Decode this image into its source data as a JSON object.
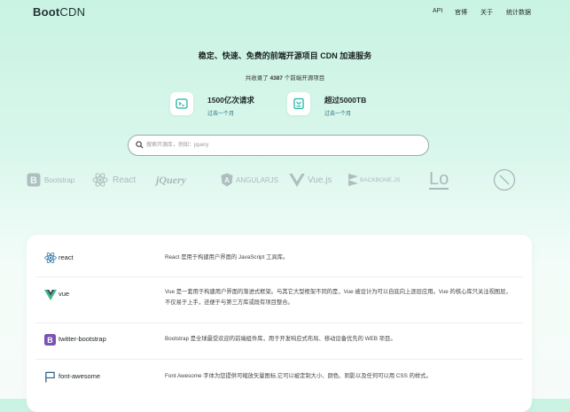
{
  "header": {
    "logo_a": "Boot",
    "logo_b": "CDN",
    "nav": [
      "API",
      "官博",
      "关于",
      "统计数据"
    ]
  },
  "hero": {
    "tagline": "稳定、快速、免费的前端开源项目 CDN 加速服务",
    "count_prefix": "共收录了",
    "count_value": "4387",
    "count_suffix": "个前端开源项目",
    "stats": [
      {
        "icon": "terminal-icon",
        "value": "1500亿次请求",
        "period": "过去一个月"
      },
      {
        "icon": "storage-icon",
        "value": "超过5000TB",
        "period": "过去一个月"
      }
    ]
  },
  "search": {
    "placeholder": "搜索开源库，例如：jquery"
  },
  "logo_strip": [
    "Bootstrap",
    "React",
    "jQuery",
    "ANGULARJS",
    "Vue.js",
    "BACKBONE.JS",
    "Lo",
    "clock"
  ],
  "libraries": [
    {
      "name": "react",
      "icon": "react-icon",
      "desc": "React 是用于构建用户界面的 JavaScript 工具库。"
    },
    {
      "name": "vue",
      "icon": "vue-icon",
      "desc": "Vue 是一套用于构建用户界面的渐进式框架。与其它大型框架不同的是，Vue 被设计为可以自底向上逐层应用。Vue 的核心库只关注视图层，不仅易于上手，还便于与第三方库或既有项目整合。"
    },
    {
      "name": "twitter-bootstrap",
      "icon": "bootstrap-icon",
      "desc": "Bootstrap 是全球最受欢迎的前端组件库，用于开发响应式布局、移动设备优先的 WEB 项目。"
    },
    {
      "name": "font-awesome",
      "icon": "flag-icon",
      "desc": "Font Awesome 字体为您提供可缩放矢量图标,它可以被定制大小、颜色、阴影以及任何可以用 CSS 的样式。"
    }
  ],
  "colors": {
    "accent": "#1fb5a5",
    "react": "#3a7fb0",
    "vue_green": "#41b883",
    "vue_dark": "#35495e",
    "bootstrap": "#7952b3"
  }
}
